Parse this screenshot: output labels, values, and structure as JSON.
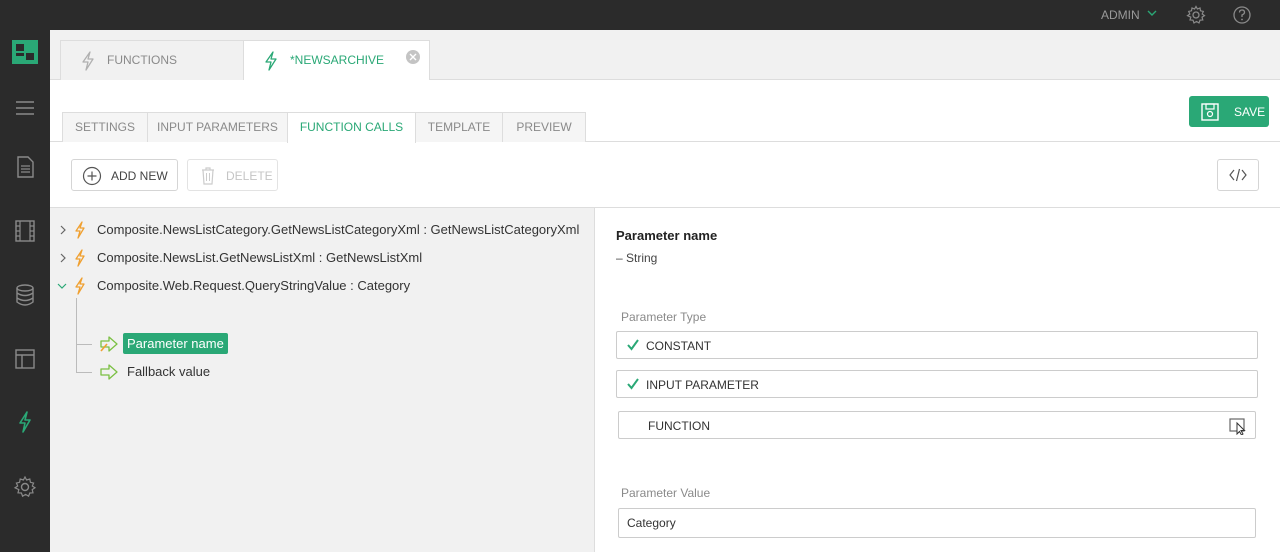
{
  "topbar": {
    "user_label": "ADMIN",
    "icons": [
      "chevron-down-icon",
      "gear-icon",
      "help-icon"
    ]
  },
  "sidebar": {
    "items": [
      {
        "name": "logo"
      },
      {
        "name": "menu-icon"
      },
      {
        "name": "pages-icon"
      },
      {
        "name": "media-icon"
      },
      {
        "name": "data-icon"
      },
      {
        "name": "layout-icon"
      },
      {
        "name": "functions-icon",
        "active": true
      },
      {
        "name": "system-icon"
      }
    ]
  },
  "doc_tabs": [
    {
      "label": "FUNCTIONS",
      "active": false
    },
    {
      "label": "*NEWSARCHIVE",
      "active": true
    }
  ],
  "sub_tabs": [
    {
      "label": "SETTINGS"
    },
    {
      "label": "INPUT PARAMETERS"
    },
    {
      "label": "FUNCTION CALLS",
      "active": true
    },
    {
      "label": "TEMPLATE"
    },
    {
      "label": "PREVIEW"
    }
  ],
  "save_label": "SAVE",
  "actions": {
    "add_new": "ADD NEW",
    "delete": "DELETE"
  },
  "tree": {
    "calls": [
      {
        "label": "Composite.NewsListCategory.GetNewsListCategoryXml : GetNewsListCategoryXml",
        "expanded": false
      },
      {
        "label": "Composite.NewsList.GetNewsListXml : GetNewsListXml",
        "expanded": false
      },
      {
        "label": "Composite.Web.Request.QueryStringValue : Category",
        "expanded": true
      }
    ],
    "params": [
      {
        "label": "Parameter name",
        "selected": true
      },
      {
        "label": "Fallback value",
        "selected": false
      }
    ]
  },
  "props": {
    "title": "Parameter name",
    "type_text": "– String",
    "param_type_label": "Parameter Type",
    "options": [
      {
        "label": "CONSTANT",
        "checked": true
      },
      {
        "label": "INPUT PARAMETER",
        "checked": true
      },
      {
        "label": "FUNCTION",
        "checked": false
      }
    ],
    "param_value_label": "Parameter Value",
    "param_value": "Category"
  },
  "colors": {
    "accent": "#2aa876",
    "sidebar_bg": "#2b2b2b",
    "function_icon": "#f0a030"
  }
}
